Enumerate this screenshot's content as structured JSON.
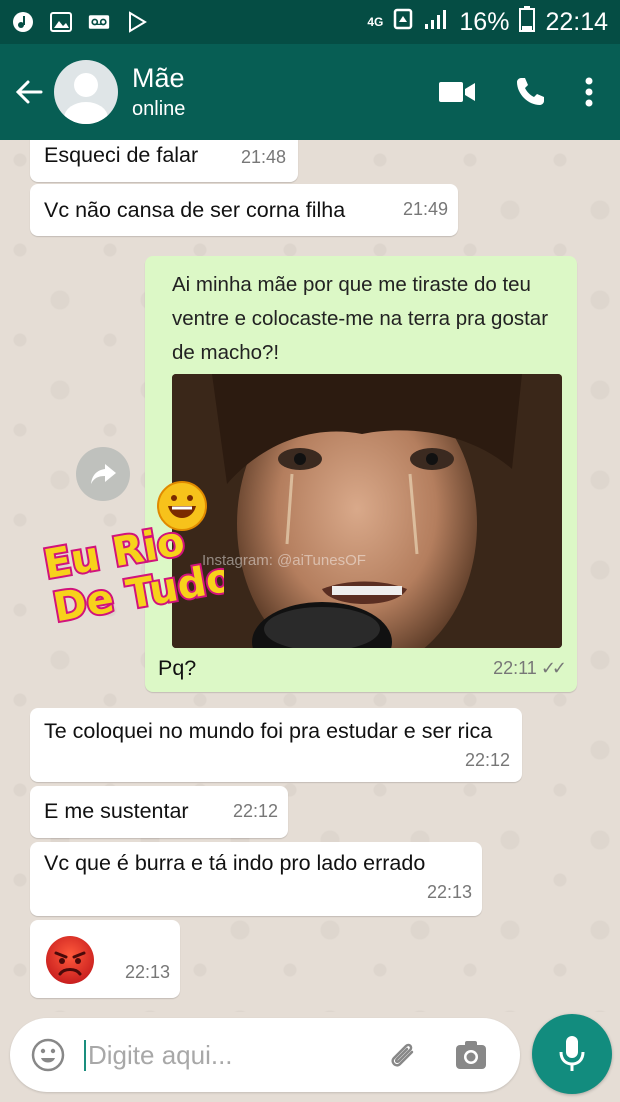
{
  "status_bar": {
    "icons_left": [
      "music-icon",
      "image-icon",
      "voicemail-icon",
      "play-store-icon"
    ],
    "network": "4G",
    "battery_percent": "16%",
    "time": "22:14"
  },
  "header": {
    "contact_name": "Mãe",
    "contact_status": "online"
  },
  "messages": [
    {
      "direction": "in",
      "text": "Esqueci de falar",
      "time": "21:48"
    },
    {
      "direction": "in",
      "text": "Vc não cansa de ser corna filha",
      "time": "21:49"
    },
    {
      "direction": "out",
      "text": "Ai minha mãe por que me tiraste do teu ventre e colocaste-me na terra pra gostar de macho?!",
      "image_watermark": "Instagram: @aiTunesOF",
      "caption": "Pq?",
      "time": "22:11",
      "status": "read"
    },
    {
      "direction": "in",
      "text": "Te coloquei no mundo foi pra estudar e ser rica",
      "time": "22:12"
    },
    {
      "direction": "in",
      "text": "E me sustentar",
      "time": "22:12"
    },
    {
      "direction": "in",
      "text": "Vc que é burra e tá indo pro lado errado",
      "time": "22:13"
    },
    {
      "direction": "in",
      "emoji": "angry-face",
      "time": "22:13"
    }
  ],
  "overlay_logo": "Eu Rio De Tudo",
  "input": {
    "placeholder": "Digite aqui..."
  },
  "colors": {
    "status_bar": "#054d44",
    "app_bar": "#075e54",
    "chat_bg": "#e5ddd5",
    "outgoing_bubble": "#dcf8c6",
    "incoming_bubble": "#ffffff",
    "mic_button": "#128c7e"
  }
}
